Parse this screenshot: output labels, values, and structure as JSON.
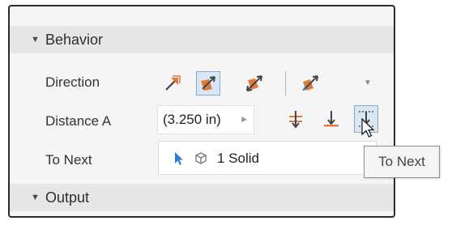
{
  "behavior": {
    "title": "Behavior"
  },
  "direction": {
    "label": "Direction",
    "buttons": [
      {
        "icon": "direction-default-icon",
        "selected": false
      },
      {
        "icon": "direction-flipped-icon",
        "selected": true
      },
      {
        "icon": "direction-symmetric-icon",
        "selected": false
      },
      {
        "icon": "direction-asymmetric-icon",
        "selected": false
      }
    ]
  },
  "distance": {
    "label": "Distance A",
    "value": "(3.250 in)",
    "buttons": [
      {
        "icon": "distance-mode-icon"
      },
      {
        "icon": "through-all-icon"
      },
      {
        "icon": "to-next-icon"
      }
    ]
  },
  "to_next": {
    "label": "To Next",
    "selection": "1 Solid"
  },
  "tooltip": {
    "text": "To Next"
  },
  "output": {
    "title": "Output"
  },
  "colors": {
    "accent": "#e07a3a",
    "select_blue": "#2d7fd3",
    "selected_bg": "#d9e6f3"
  }
}
